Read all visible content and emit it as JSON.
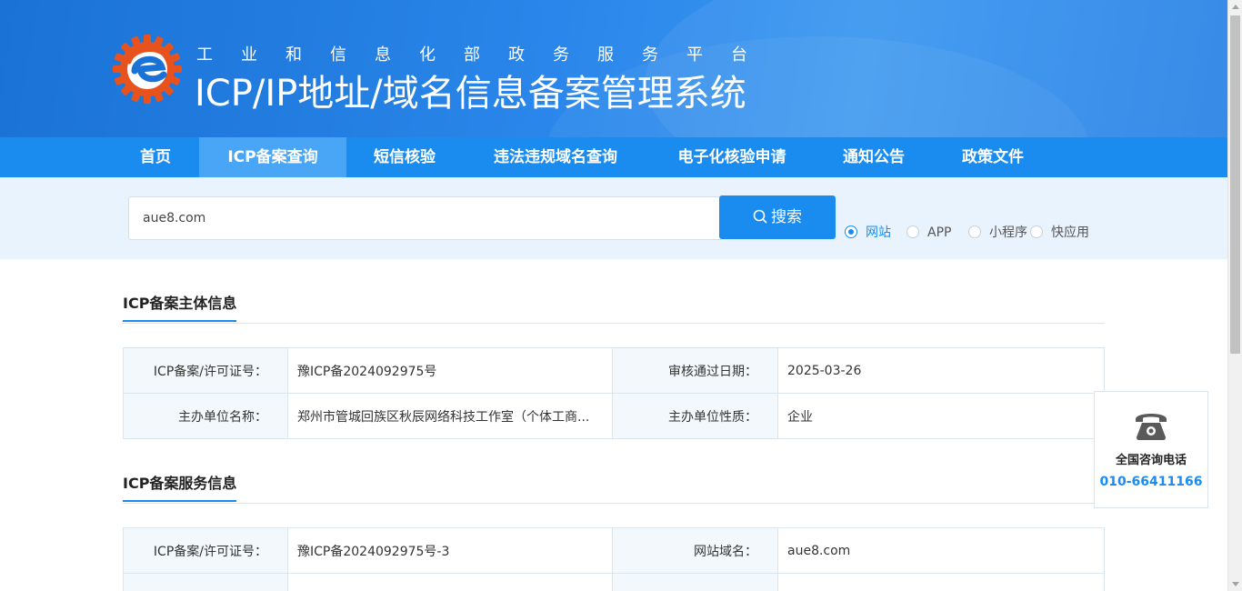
{
  "header": {
    "subtitle": "工业和信息化部政务服务平台",
    "title": "ICP/IP地址/域名信息备案管理系统"
  },
  "nav": {
    "items": [
      {
        "label": "首页"
      },
      {
        "label": "ICP备案查询",
        "active": true
      },
      {
        "label": "短信核验"
      },
      {
        "label": "违法违规域名查询"
      },
      {
        "label": "电子化核验申请"
      },
      {
        "label": "通知公告"
      },
      {
        "label": "政策文件"
      }
    ]
  },
  "search": {
    "value": "aue8.com",
    "button_label": "搜索",
    "types": [
      {
        "label": "网站",
        "checked": true
      },
      {
        "label": "APP",
        "checked": false
      },
      {
        "label": "小程序",
        "checked": false
      },
      {
        "label": "快应用",
        "checked": false
      }
    ]
  },
  "subject_info": {
    "title": "ICP备案主体信息",
    "rows": [
      {
        "k1": "ICP备案/许可证号：",
        "v1": "豫ICP备2024092975号",
        "k2": "审核通过日期：",
        "v2": "2025-03-26"
      },
      {
        "k1": "主办单位名称：",
        "v1": "郑州市管城回族区秋辰网络科技工作室（个体工商...",
        "k2": "主办单位性质：",
        "v2": "企业"
      }
    ]
  },
  "service_info": {
    "title": "ICP备案服务信息",
    "rows": [
      {
        "k1": "ICP备案/许可证号：",
        "v1": "豫ICP备2024092975号-3",
        "k2": "网站域名：",
        "v2": "aue8.com"
      },
      {
        "k1": "",
        "v1": "",
        "k2": "",
        "v2": ""
      }
    ]
  },
  "contact": {
    "icon": "phone-icon",
    "label": "全国咨询电话",
    "number": "010-66411166"
  },
  "colors": {
    "primary": "#1a8cf0",
    "nav_active": "#49a6f7",
    "search_band": "#e8f3fd",
    "key_cell": "#f3f8fd"
  }
}
